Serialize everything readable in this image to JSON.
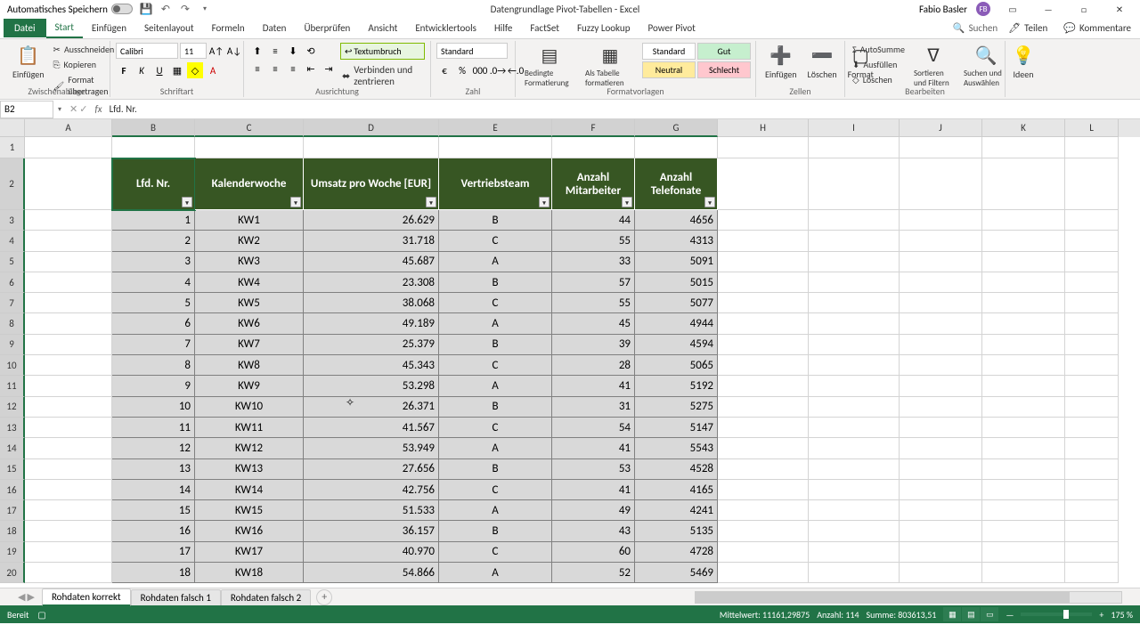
{
  "titlebar": {
    "autosave": "Automatisches Speichern",
    "title": "Datengrundlage Pivot-Tabellen - Excel",
    "user": "Fabio Basler",
    "user_initials": "FB"
  },
  "tabs": {
    "file": "Datei",
    "items": [
      "Start",
      "Einfügen",
      "Seitenlayout",
      "Formeln",
      "Daten",
      "Überprüfen",
      "Ansicht",
      "Entwicklertools",
      "Hilfe",
      "FactSet",
      "Fuzzy Lookup",
      "Power Pivot"
    ],
    "search": "Suchen",
    "share": "Teilen",
    "comments": "Kommentare"
  },
  "ribbon": {
    "clipboard": {
      "paste": "Einfügen",
      "cut": "Ausschneiden",
      "copy": "Kopieren",
      "format_painter": "Format übertragen"
    },
    "font": {
      "name": "Calibri",
      "size": "11"
    },
    "alignment": {
      "wrap": "Textumbruch",
      "merge": "Verbinden und zentrieren"
    },
    "number": {
      "std": "Standard"
    },
    "styles": {
      "cond": "Bedingte Formatierung",
      "table": "Als Tabelle formatieren",
      "s1": "Standard",
      "s2": "Gut",
      "s3": "Neutral",
      "s4": "Schlecht"
    },
    "cells": {
      "ins": "Einfügen",
      "del": "Löschen",
      "fmt": "Format"
    },
    "editing": {
      "sum": "AutoSumme",
      "fill": "Ausfüllen",
      "clear": "Löschen",
      "sort": "Sortieren und Filtern",
      "find": "Suchen und Auswählen"
    },
    "ideas": "Ideen",
    "groups": {
      "clipboard": "Zwischenablage",
      "font": "Schriftart",
      "alignment": "Ausrichtung",
      "number": "Zahl",
      "styles": "Formatvorlagen",
      "cells": "Zellen",
      "editing": "Bearbeiten"
    }
  },
  "namebox": "B2",
  "formula": "Lfd. Nr.",
  "cols": [
    "A",
    "B",
    "C",
    "D",
    "E",
    "F",
    "G",
    "H",
    "I",
    "J",
    "K",
    "L"
  ],
  "headers": [
    "Lfd. Nr.",
    "Kalenderwoche",
    "Umsatz pro Woche [EUR]",
    "Vertriebsteam",
    "Anzahl Mitarbeiter",
    "Anzahl Telefonate"
  ],
  "chart_data": {
    "type": "table",
    "columns": [
      "Lfd. Nr.",
      "Kalenderwoche",
      "Umsatz pro Woche [EUR]",
      "Vertriebsteam",
      "Anzahl Mitarbeiter",
      "Anzahl Telefonate"
    ],
    "rows": [
      [
        1,
        "KW1",
        "26.629",
        "B",
        44,
        4656
      ],
      [
        2,
        "KW2",
        "31.718",
        "C",
        55,
        4313
      ],
      [
        3,
        "KW3",
        "45.687",
        "A",
        33,
        5091
      ],
      [
        4,
        "KW4",
        "23.308",
        "B",
        57,
        5015
      ],
      [
        5,
        "KW5",
        "38.068",
        "C",
        55,
        5077
      ],
      [
        6,
        "KW6",
        "49.189",
        "A",
        45,
        4944
      ],
      [
        7,
        "KW7",
        "25.379",
        "B",
        39,
        4594
      ],
      [
        8,
        "KW8",
        "45.343",
        "C",
        28,
        5065
      ],
      [
        9,
        "KW9",
        "53.298",
        "A",
        41,
        5192
      ],
      [
        10,
        "KW10",
        "26.371",
        "B",
        31,
        5275
      ],
      [
        11,
        "KW11",
        "41.567",
        "C",
        54,
        5147
      ],
      [
        12,
        "KW12",
        "53.949",
        "A",
        41,
        5543
      ],
      [
        13,
        "KW13",
        "27.656",
        "B",
        53,
        4528
      ],
      [
        14,
        "KW14",
        "42.756",
        "C",
        41,
        4165
      ],
      [
        15,
        "KW15",
        "51.533",
        "A",
        49,
        4241
      ],
      [
        16,
        "KW16",
        "36.157",
        "B",
        43,
        5135
      ],
      [
        17,
        "KW17",
        "40.970",
        "C",
        60,
        4728
      ],
      [
        18,
        "KW18",
        "54.866",
        "A",
        52,
        5469
      ]
    ]
  },
  "sheets": {
    "active": "Rohdaten korrekt",
    "others": [
      "Rohdaten falsch 1",
      "Rohdaten falsch 2"
    ]
  },
  "status": {
    "ready": "Bereit",
    "avg": "Mittelwert: 11161,29875",
    "count": "Anzahl: 114",
    "sum": "Summe: 803613,51",
    "zoom": "175 %"
  }
}
